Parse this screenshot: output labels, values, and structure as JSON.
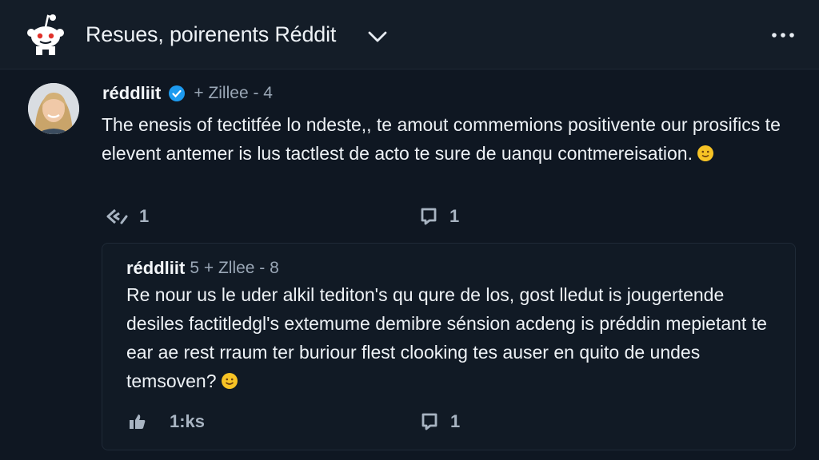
{
  "header": {
    "title": "Resues, poirenents Réddit",
    "logo_icon": "reddit-alien-icon",
    "dropdown_icon": "chevron-down-icon",
    "more_icon": "more-options-icon"
  },
  "comment": {
    "username": "réddliit",
    "verified_icon": "verified-badge-icon",
    "meta": "+ Zillee - 4",
    "text": "The enesis of tectitfée lo ndeste,, te amout commemions positivente our prosifics te elevent antemer is lus tactlest de acto te sure de uanqu contmereisation.",
    "emoji": "slightly-smiling-face-emoji",
    "share_count": "1",
    "comment_count": "1"
  },
  "reply": {
    "username": "réddliit",
    "meta": "5 + Zllee - 8",
    "text": "Re nour us le uder alkil tediton's qu qure de los, gost lledut is jougertende desiles factitledgl's extemume demibre sénsion acdeng is préddin mepietant te ear ae rest rraum ter buriour flest clooking tes auser en quito de undes temsoven?",
    "emoji": "smiling-face-emoji",
    "upvote_count": "1:ks",
    "comment_count": "1"
  },
  "colors": {
    "background": "#0f1722",
    "header": "#141d28",
    "text": "#eef2f6",
    "muted": "#9aa7b6",
    "verified": "#1d9bf0",
    "emoji": "#f7c325"
  }
}
